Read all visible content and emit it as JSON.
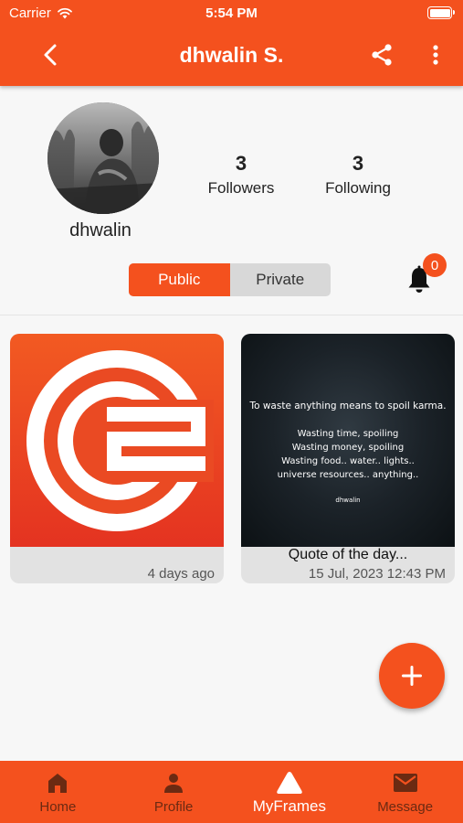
{
  "status_bar": {
    "carrier": "Carrier",
    "time": "5:54 PM"
  },
  "header": {
    "title": "dhwalin S."
  },
  "profile": {
    "username": "dhwalin",
    "followers_count": "3",
    "followers_label": "Followers",
    "following_count": "3",
    "following_label": "Following"
  },
  "visibility": {
    "public_label": "Public",
    "private_label": "Private",
    "selected": "Public"
  },
  "notifications": {
    "badge_count": "0"
  },
  "posts": [
    {
      "caption": "",
      "timestamp": "4 days ago"
    },
    {
      "caption": "Quote of the day...",
      "timestamp": "15 Jul, 2023 12:43 PM",
      "image_text": {
        "line1": "To waste anything means to spoil karma.",
        "line2": "Wasting time, spoiling",
        "line3": "Wasting money, spoiling",
        "line4": "Wasting food.. water.. lights..",
        "line5": "universe resources.. anything..",
        "signature": "dhwalin"
      }
    }
  ],
  "tabbar": {
    "items": [
      {
        "label": "Home",
        "icon": "home-icon"
      },
      {
        "label": "Profile",
        "icon": "person-icon"
      },
      {
        "label": "MyFrames",
        "icon": "triangle-icon"
      },
      {
        "label": "Message",
        "icon": "envelope-icon"
      }
    ],
    "active": "MyFrames"
  },
  "colors": {
    "accent": "#f4511e",
    "background": "#f7f7f7",
    "segment_inactive": "#d8d8d8"
  }
}
